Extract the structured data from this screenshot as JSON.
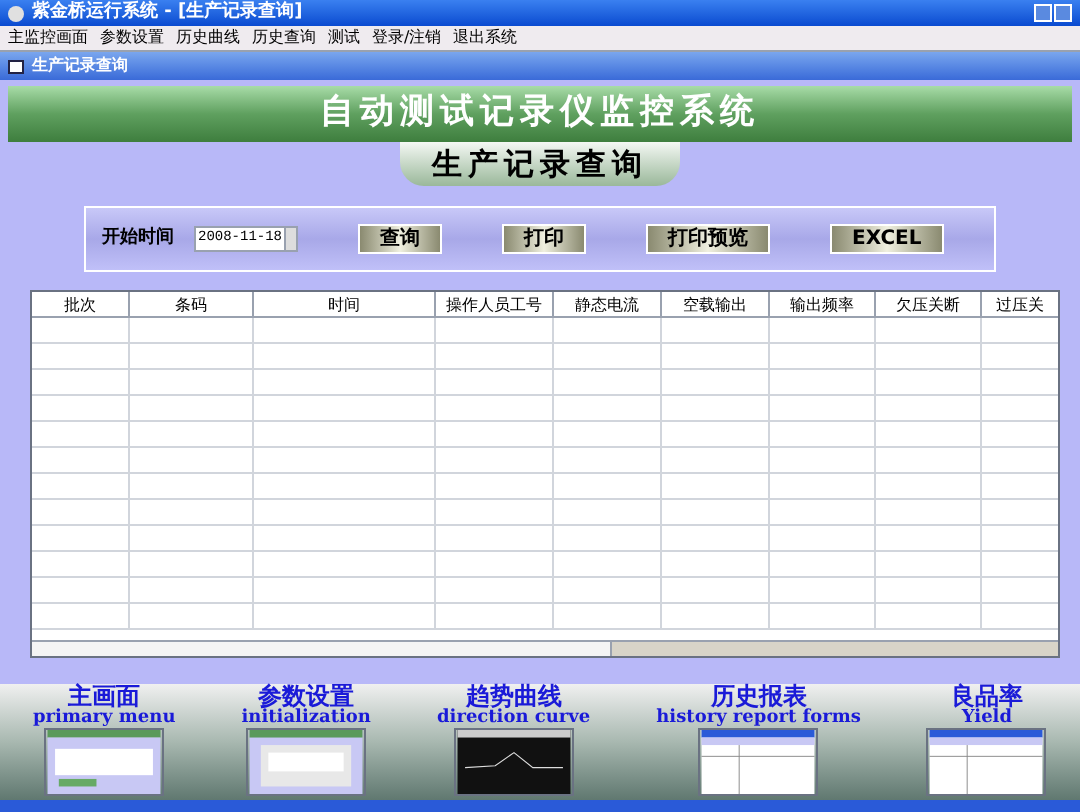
{
  "window": {
    "title": "紫金桥运行系统 - [生产记录查询]"
  },
  "menu": [
    "主监控画面",
    "参数设置",
    "历史曲线",
    "历史查询",
    "测试",
    "登录/注销",
    "退出系统"
  ],
  "child_window": {
    "title": "生产记录查询"
  },
  "header": {
    "title": "自动测试记录仪监控系统",
    "subtitle": "生产记录查询"
  },
  "toolbar": {
    "label": "开始时间",
    "date": "2008-11-18",
    "buttons": [
      "查询",
      "打印",
      "打印预览",
      "EXCEL"
    ]
  },
  "table": {
    "columns": [
      "批次",
      "条码",
      "时间",
      "操作人员工号",
      "静态电流",
      "空载输出",
      "输出频率",
      "欠压关断",
      "过压关"
    ]
  },
  "nav": [
    {
      "title": "主画面",
      "subtitle": "primary menu",
      "kind": "menu"
    },
    {
      "title": "参数设置",
      "subtitle": "initialization",
      "kind": "dialog"
    },
    {
      "title": "趋势曲线",
      "subtitle": "direction curve",
      "kind": "chart"
    },
    {
      "title": "历史报表",
      "subtitle": "history report forms",
      "kind": "table"
    },
    {
      "title": "良品率",
      "subtitle": "Yield",
      "kind": "table"
    }
  ]
}
